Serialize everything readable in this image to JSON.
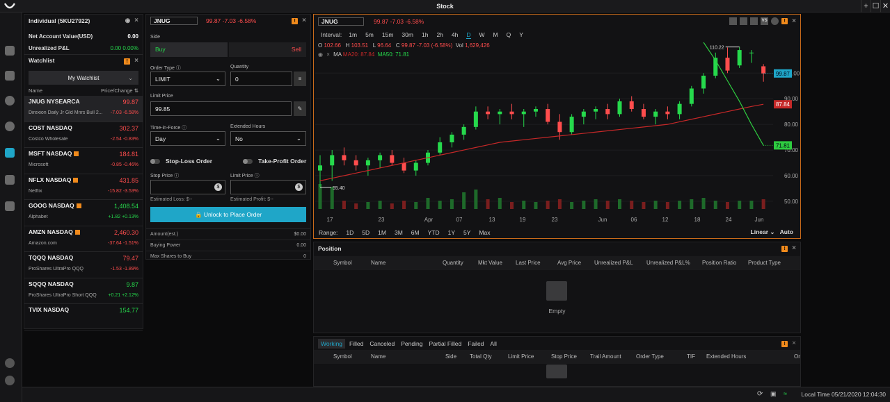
{
  "app": {
    "title": "Stock"
  },
  "window": {
    "btn_add": "+",
    "btn_max": "☐",
    "btn_close": "✕"
  },
  "account": {
    "name": "Individual (5KU27922)",
    "rows": [
      {
        "label": "Net Account Value(USD)",
        "value": "0.00",
        "change": ""
      },
      {
        "label": "Unrealized P&L",
        "value": "0.00",
        "change": "0.00%"
      }
    ]
  },
  "watchlist": {
    "title": "Watchlist",
    "selector": "My Watchlist",
    "col_name": "Name",
    "col_price": "Price/Change",
    "items": [
      {
        "symbol": "JNUG NYSEARCA",
        "name": "Direxion Daily Jr Gld Mnrs Bull 2...",
        "price": "99.87",
        "change": "-7.03",
        "pct": "-6.58%",
        "dir": "down",
        "flag": false
      },
      {
        "symbol": "COST NASDAQ",
        "name": "Costco Wholesale",
        "price": "302.37",
        "change": "-2.54",
        "pct": "-0.83%",
        "dir": "down",
        "flag": false
      },
      {
        "symbol": "MSFT NASDAQ",
        "name": "Microsoft",
        "price": "184.81",
        "change": "-0.85",
        "pct": "-0.46%",
        "dir": "down",
        "flag": true
      },
      {
        "symbol": "NFLX NASDAQ",
        "name": "Netflix",
        "price": "431.85",
        "change": "-15.82",
        "pct": "-3.53%",
        "dir": "down",
        "flag": true
      },
      {
        "symbol": "GOOG NASDAQ",
        "name": "Alphabet",
        "price": "1,408.54",
        "change": "+1.82",
        "pct": "+0.13%",
        "dir": "up",
        "flag": true
      },
      {
        "symbol": "AMZN NASDAQ",
        "name": "Amazon.com",
        "price": "2,460.30",
        "change": "-37.64",
        "pct": "-1.51%",
        "dir": "down",
        "flag": true
      },
      {
        "symbol": "TQQQ NASDAQ",
        "name": "ProShares UltraPro QQQ",
        "price": "79.47",
        "change": "-1.53",
        "pct": "-1.89%",
        "dir": "down",
        "flag": false
      },
      {
        "symbol": "SQQQ NASDAQ",
        "name": "ProShares UltraPro Short QQQ",
        "price": "9.87",
        "change": "+0.21",
        "pct": "+2.12%",
        "dir": "up",
        "flag": false
      },
      {
        "symbol": "TVIX NASDAQ",
        "name": "",
        "price": "154.77",
        "change": "",
        "pct": "",
        "dir": "up",
        "flag": false
      }
    ]
  },
  "order": {
    "symbol": "JNUG",
    "price": "99.87",
    "change": "-7.03",
    "pct": "-6.58%",
    "side_label": "Side",
    "buy": "Buy",
    "sell": "Sell",
    "order_type_label": "Order Type",
    "order_type": "LIMIT",
    "qty_label": "Quantity",
    "qty": "0",
    "limit_price_label": "Limit Price",
    "limit_price": "99.85",
    "tif_label": "Time-in-Force",
    "tif": "Day",
    "ext_label": "Extended Hours",
    "ext": "No",
    "stop_loss": "Stop-Loss Order",
    "take_profit": "Take-Profit Order",
    "stop_price_label": "Stop Price",
    "limit_price2_label": "Limit Price",
    "est_loss": "Estimated Loss: $--",
    "est_profit": "Estimated Profit: $--",
    "unlock": "Unlock to Place Order",
    "summary": [
      {
        "label": "Amount(est.)",
        "value": "$0.00"
      },
      {
        "label": "Buying Power",
        "value": "0.00"
      },
      {
        "label": "Max Shares to Buy",
        "value": "0"
      }
    ]
  },
  "chart": {
    "symbol": "JNUG",
    "price": "99.87",
    "change": "-7.03",
    "pct": "-6.58%",
    "interval_label": "Interval:",
    "intervals": [
      "1m",
      "5m",
      "15m",
      "30m",
      "1h",
      "2h",
      "4h",
      "D",
      "W",
      "M",
      "Q",
      "Y"
    ],
    "active_interval": "D",
    "ohlc": {
      "o_label": "O",
      "o": "102.66",
      "h_label": "H",
      "h": "103.51",
      "l_label": "L",
      "l": "96.64",
      "c_label": "C",
      "c": "99.87 -7.03 (-6.58%)",
      "vol_label": "Vol",
      "vol": "1,629,426"
    },
    "ma_label": "MA",
    "ma20": "MA20: 87.84",
    "ma50": "MA50: 71.81",
    "range_label": "Range:",
    "ranges": [
      "1D",
      "5D",
      "1M",
      "3M",
      "6M",
      "YTD",
      "1Y",
      "5Y",
      "Max"
    ],
    "scale": "Linear",
    "auto": "Auto",
    "tag_price": "99.87",
    "tag_ma20": "87.84",
    "tag_ma50": "71.81",
    "label_high": "110.22",
    "label_low": "55.40"
  },
  "chart_data": {
    "type": "candlestick",
    "x_ticks": [
      "17",
      "23",
      "Apr",
      "07",
      "13",
      "19",
      "23",
      "Jun",
      "06",
      "12",
      "18",
      "24",
      "Jun"
    ],
    "y_ticks": [
      50,
      60,
      70,
      80,
      90,
      100
    ],
    "y_tick_labels": [
      "50.00",
      "60.00",
      "70.00",
      "80.00",
      "90.00",
      "100.00"
    ],
    "ylim": [
      47,
      112
    ],
    "candles": [
      [
        62,
        68,
        55.4,
        64
      ],
      [
        64,
        70,
        58,
        68
      ],
      [
        68,
        71,
        64,
        66
      ],
      [
        66,
        68,
        62,
        64
      ],
      [
        64,
        67,
        60,
        66
      ],
      [
        66,
        69,
        63,
        68
      ],
      [
        68,
        70,
        64,
        65
      ],
      [
        65,
        67,
        61,
        62
      ],
      [
        62,
        66,
        60,
        65
      ],
      [
        65,
        70,
        64,
        69
      ],
      [
        69,
        75,
        68,
        73
      ],
      [
        73,
        77,
        71,
        76
      ],
      [
        76,
        80,
        74,
        79
      ],
      [
        79,
        87,
        78,
        85
      ],
      [
        85,
        87,
        82,
        84
      ],
      [
        84,
        86,
        80,
        85
      ],
      [
        85,
        88,
        82,
        84
      ],
      [
        84,
        86,
        79,
        85
      ],
      [
        85,
        87,
        83,
        86
      ],
      [
        86,
        88,
        80,
        81
      ],
      [
        81,
        84,
        74,
        77
      ],
      [
        77,
        84,
        76,
        83
      ],
      [
        83,
        86,
        80,
        85
      ],
      [
        85,
        87,
        82,
        86
      ],
      [
        86,
        88,
        82,
        84
      ],
      [
        84,
        90,
        83,
        89
      ],
      [
        89,
        91,
        85,
        86
      ],
      [
        86,
        88,
        82,
        83
      ],
      [
        83,
        86,
        80,
        85
      ],
      [
        85,
        87,
        82,
        84
      ],
      [
        84,
        89,
        82,
        88
      ],
      [
        88,
        95,
        87,
        94
      ],
      [
        94,
        100,
        92,
        99
      ],
      [
        99,
        108,
        98,
        106
      ],
      [
        106,
        110,
        100,
        101
      ],
      [
        103,
        110.22,
        102,
        109
      ],
      [
        108,
        109,
        104,
        108
      ],
      [
        102.66,
        103.51,
        96.64,
        99.87
      ]
    ],
    "volume": [
      0.9,
      0.8,
      0.3,
      0.2,
      0.25,
      0.3,
      0.2,
      0.3,
      0.25,
      0.4,
      0.3,
      0.35,
      0.6,
      0.7,
      0.35,
      0.4,
      0.25,
      0.3,
      0.25,
      0.3,
      0.35,
      0.25,
      0.3,
      0.35,
      0.3,
      0.35,
      0.3,
      0.25,
      0.3,
      0.25,
      0.3,
      0.35,
      0.4,
      0.3,
      0.25,
      0.3,
      0.3,
      0.35
    ],
    "ma20": [
      58,
      59,
      60,
      61,
      62,
      63,
      64,
      65,
      66,
      67,
      68,
      69,
      70,
      71,
      72,
      73,
      73.5,
      74,
      74.5,
      75,
      75.5,
      76,
      76.5,
      77,
      77.5,
      78,
      78.5,
      79,
      79.5,
      80,
      81,
      82,
      83,
      84,
      85,
      86,
      87,
      87.84
    ],
    "ma50": [
      null,
      null,
      null,
      null,
      null,
      null,
      null,
      null,
      null,
      null,
      null,
      null,
      null,
      null,
      null,
      null,
      null,
      null,
      null,
      null,
      null,
      null,
      null,
      null,
      null,
      null,
      null,
      null,
      null,
      null,
      null,
      null,
      112,
      105,
      97,
      89,
      80,
      71.81
    ],
    "series": [
      {
        "name": "MA20",
        "values_ref": "ma20"
      },
      {
        "name": "MA50",
        "values_ref": "ma50"
      }
    ]
  },
  "position": {
    "title": "Position",
    "columns": [
      "Symbol",
      "Name",
      "Quantity",
      "Mkt Value",
      "Last Price",
      "Avg Price",
      "Unrealized P&L",
      "Unrealized P&L%",
      "Position Ratio",
      "Product Type"
    ],
    "empty": "Empty"
  },
  "orders": {
    "tabs": [
      "Working",
      "Filled",
      "Canceled",
      "Pending",
      "Partial Filled",
      "Failed",
      "All"
    ],
    "active_tab": "Working",
    "columns": [
      "Symbol",
      "Name",
      "Side",
      "Total Qty",
      "Limit Price",
      "Stop Price",
      "Trail Amount",
      "Order Type",
      "TIF",
      "Extended Hours",
      "Or"
    ]
  },
  "status": {
    "local_time": "Local Time 05/21/2020 12:04:30"
  },
  "colors": {
    "up": "#26d94c",
    "down": "#ff4d4d",
    "accent": "#1fa6c8",
    "orange": "#f08a1c",
    "ma20": "#c62828",
    "ma50": "#2ecc40"
  }
}
